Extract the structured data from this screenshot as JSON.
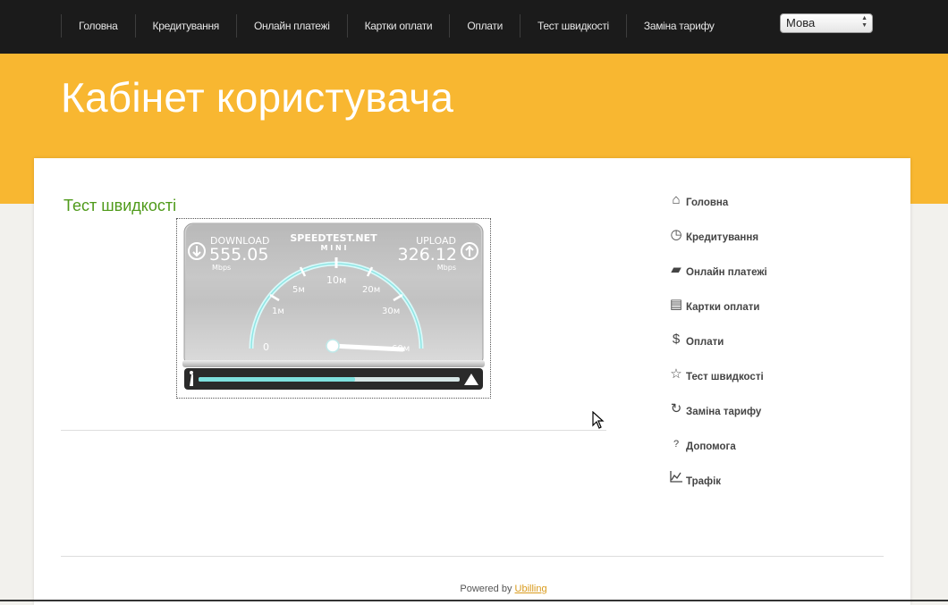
{
  "topnav": {
    "items": [
      {
        "label": "Головна"
      },
      {
        "label": "Кредитування"
      },
      {
        "label": "Онлайн платежі"
      },
      {
        "label": "Картки оплати"
      },
      {
        "label": "Оплати"
      },
      {
        "label": "Тест швидкості"
      },
      {
        "label": "Заміна тарифу"
      }
    ],
    "language_select": {
      "value": "Мова"
    }
  },
  "header": {
    "title": "Кабінет користувача"
  },
  "main": {
    "section_title": "Тест швидкості"
  },
  "speedtest": {
    "brand": "SPEEDTEST.NET",
    "brand_sub": "M I N I",
    "download_label": "DOWNLOAD",
    "download_value": "555.05",
    "download_unit": "Mbps",
    "upload_label": "UPLOAD",
    "upload_value": "326.12",
    "upload_unit": "Mbps",
    "gauge_ticks": [
      "0",
      "1м",
      "5м",
      "10м",
      "20м",
      "30м",
      "60м"
    ],
    "progress_fraction": 0.6
  },
  "sidebar": {
    "items": [
      {
        "label": "Головна",
        "icon": "home-icon"
      },
      {
        "label": "Кредитування",
        "icon": "clock-icon"
      },
      {
        "label": "Онлайн платежі",
        "icon": "card-icon"
      },
      {
        "label": "Картки оплати",
        "icon": "document-icon"
      },
      {
        "label": "Оплати",
        "icon": "dollar-icon"
      },
      {
        "label": "Тест швидкості",
        "icon": "star-icon"
      },
      {
        "label": "Заміна тарифу",
        "icon": "refresh-icon"
      },
      {
        "label": "Допомога",
        "icon": "question-icon"
      },
      {
        "label": "Трафік",
        "icon": "chart-icon"
      }
    ]
  },
  "footer": {
    "powered_by": "Powered by",
    "link": "Ubilling"
  },
  "colors": {
    "header": "#f8b731",
    "topbar": "#1b1b1b",
    "section_title": "#4f9a1a",
    "link": "#d99a1b"
  }
}
